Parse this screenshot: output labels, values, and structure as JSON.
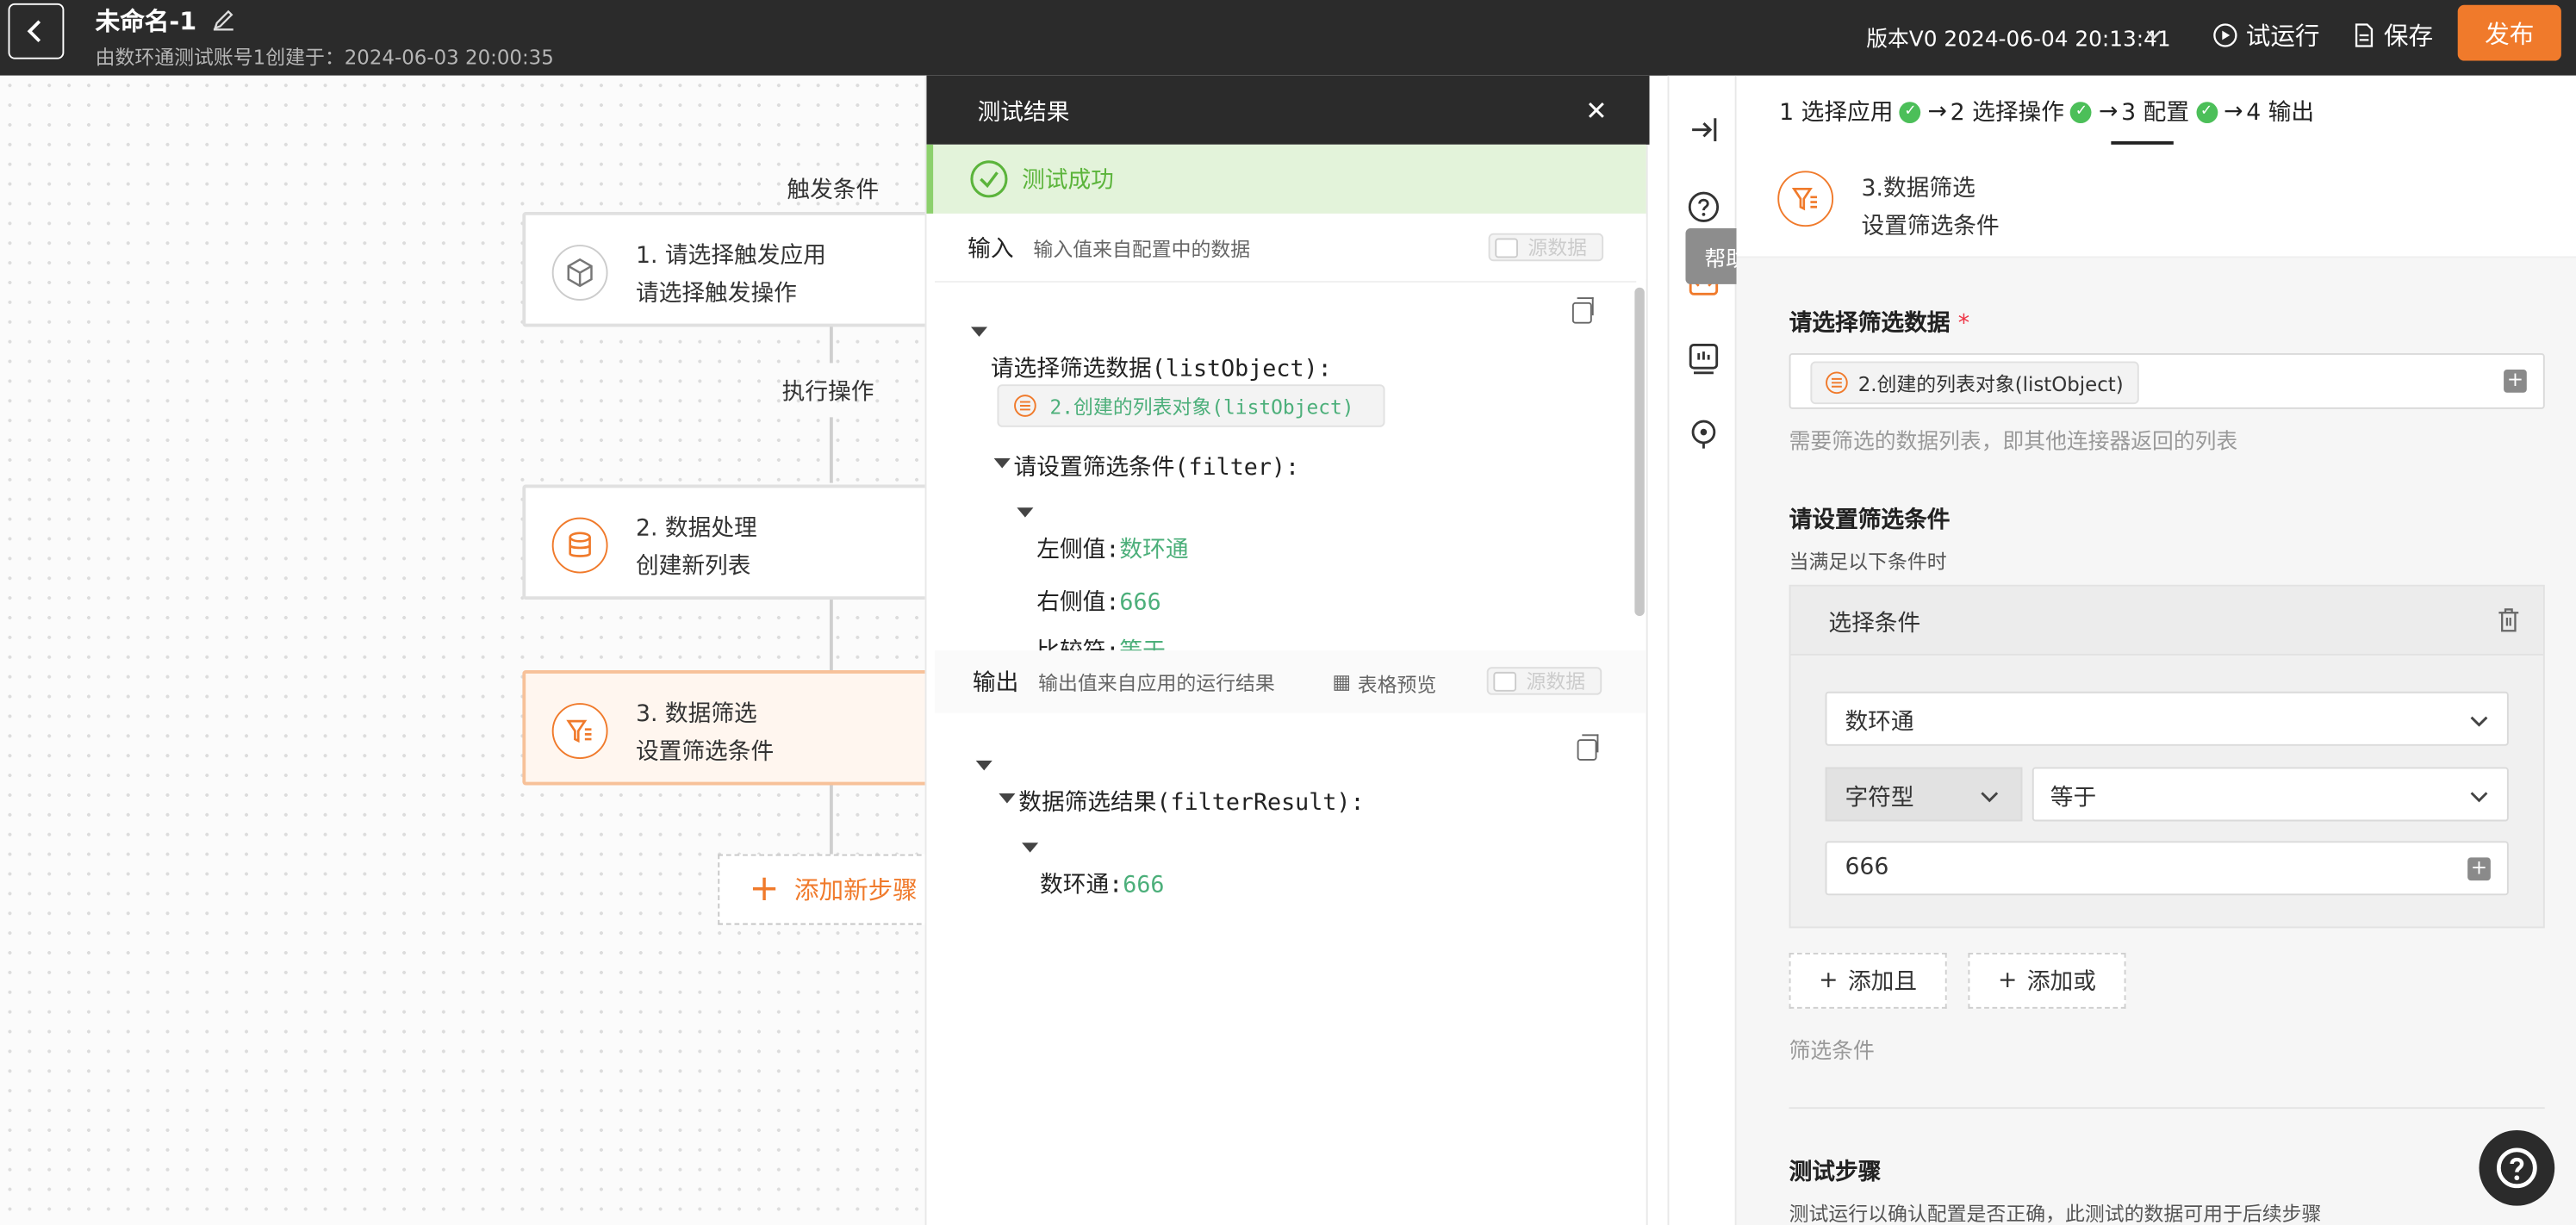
{
  "topbar": {
    "title": "未命名-1",
    "subtitle": "由数环通测试账号1创建于：2024-06-03 20:00:35",
    "version": "版本V0 2024-06-04 20:13:41",
    "test_run": "试运行",
    "save": "保存",
    "publish": "发布",
    "accent": "#f07a2b"
  },
  "flow": {
    "trigger_label": "触发条件",
    "action_label": "执行操作",
    "nodes": [
      {
        "title": "1. 请选择触发应用",
        "sub": "请选择触发操作",
        "icon": "cube-icon"
      },
      {
        "title": "2. 数据处理",
        "sub": "创建新列表",
        "icon": "database-icon"
      },
      {
        "title": "3. 数据筛选",
        "sub": "设置筛选条件",
        "icon": "filter-icon"
      }
    ],
    "add_step": "添加新步骤"
  },
  "test_result": {
    "title": "测试结果",
    "status": "测试成功",
    "input_label": "输入",
    "input_desc": "输入值来自配置中的数据",
    "raw_toggle": "源数据",
    "input_lines": {
      "list_key": "请选择筛选数据(listObject):",
      "list_chip": "2.创建的列表对象(listObject)",
      "filter_key": "请设置筛选条件(filter):",
      "left_key": "左侧值:",
      "left_val": "数环通",
      "right_key": "右侧值:",
      "right_val": "666",
      "cmp_key": "比较符:",
      "cmp_val": "等于"
    },
    "output_label": "输出",
    "output_desc": "输出值来自应用的运行结果",
    "table_preview": "表格预览",
    "output_lines": {
      "result_key": "数据筛选结果(filterResult):",
      "item_key": "数环通:",
      "item_val": "666"
    }
  },
  "iconbar": {
    "tooltip": "帮助文档"
  },
  "config": {
    "steps": [
      "1 选择应用",
      "2 选择操作",
      "3 配置",
      "4 输出"
    ],
    "header_title": "3.数据筛选",
    "header_sub": "设置筛选条件",
    "data_label": "请选择筛选数据",
    "data_chip": "2.创建的列表对象(listObject)",
    "data_hint": "需要筛选的数据列表，即其他连接器返回的列表",
    "cond_label": "请设置筛选条件",
    "cond_hint": "当满足以下条件时",
    "cond_box_title": "选择条件",
    "field_value": "数环通",
    "type_value": "字符型",
    "op_value": "等于",
    "input_value": "666",
    "add_and": "添加且",
    "add_or": "添加或",
    "filter_hint": "筛选条件",
    "test_label": "测试步骤",
    "test_hint": "测试运行以确认配置是否正确，此测试的数据可用于后续步骤"
  }
}
